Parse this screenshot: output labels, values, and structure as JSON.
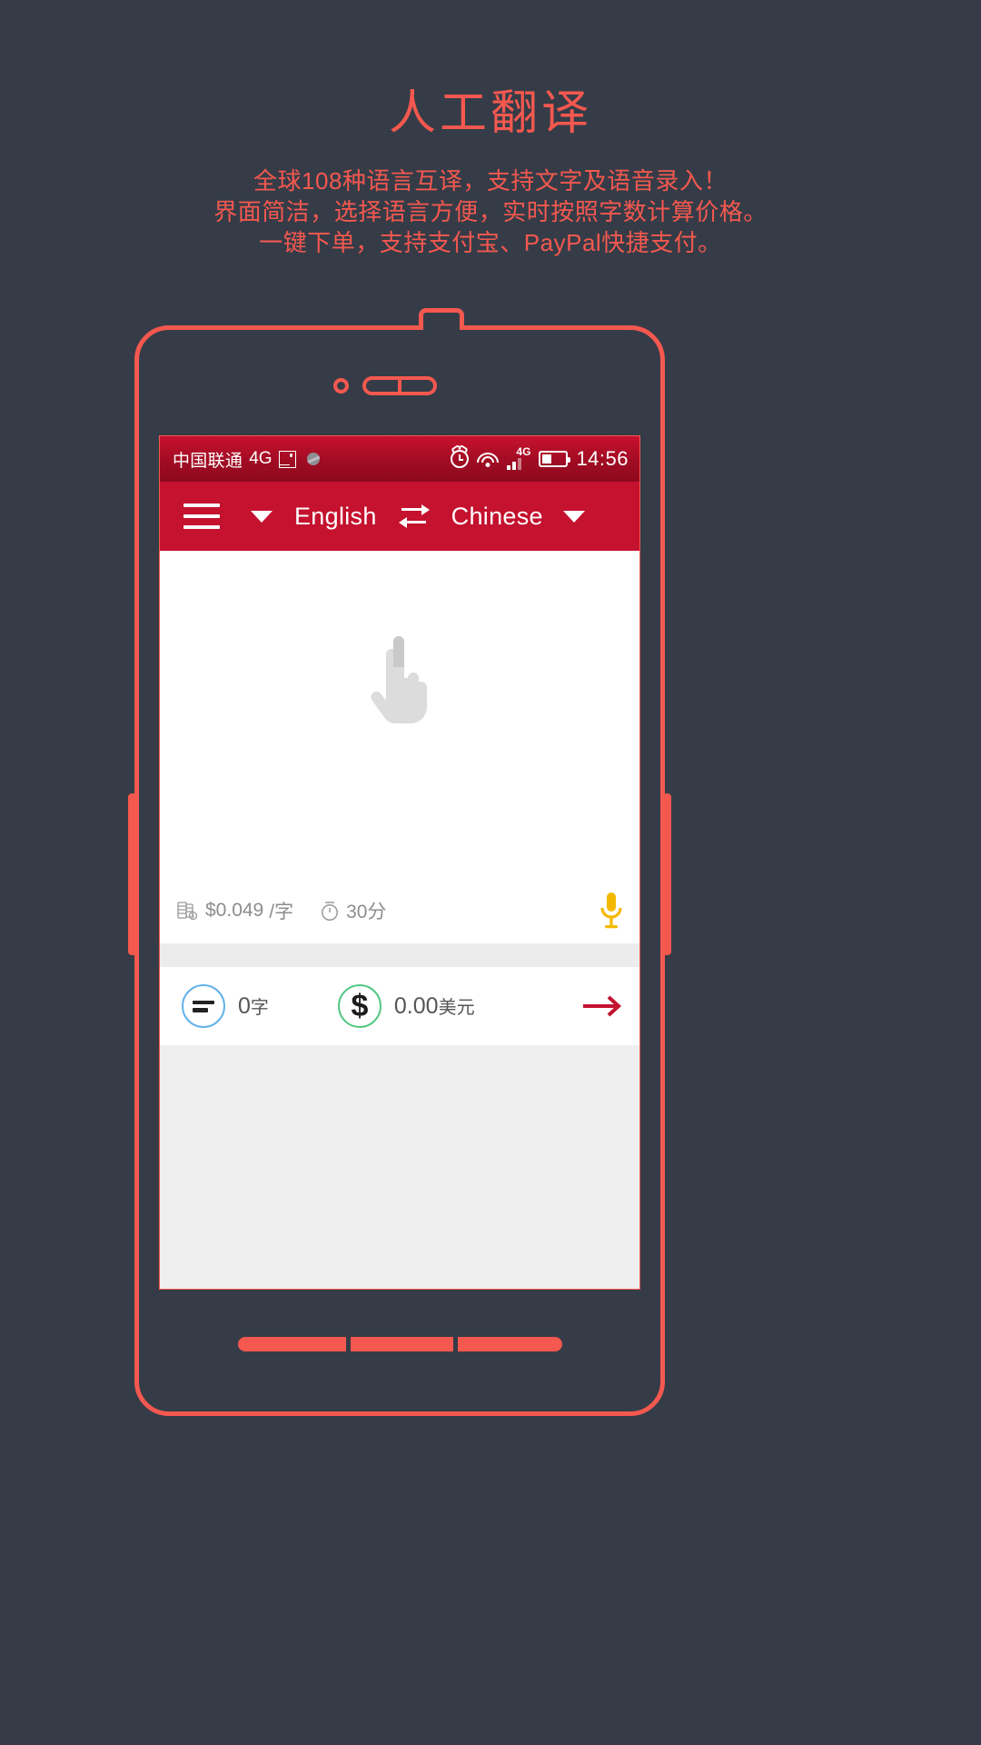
{
  "promo": {
    "title": "人工翻译",
    "lines": [
      "全球108种语言互译，支持文字及语音录入！",
      "界面简洁，选择语言方便，实时按照字数计算价格。",
      "一键下单，支持支付宝、PayPal快捷支付。"
    ],
    "accent_color": "#f4584f",
    "background_color": "#353c47"
  },
  "statusbar": {
    "carrier": "中国联通",
    "network": "4G",
    "signal_tag": "4G",
    "time": "14:56",
    "icons": [
      "screenshot-icon",
      "sync-icon",
      "alarm-icon",
      "wifi-icon",
      "signal-icon",
      "battery-icon"
    ]
  },
  "toolbar": {
    "menu_icon": "hamburger-icon",
    "source_dropdown_icon": "chevron-down-icon",
    "source_language": "English",
    "swap_icon": "swap-languages-icon",
    "target_language": "Chinese",
    "target_dropdown_icon": "chevron-down-icon",
    "background_color": "#c4122f"
  },
  "editor": {
    "placeholder_icon": "tap-hand-icon"
  },
  "price_row": {
    "rate_icon": "coins-icon",
    "rate": "$0.049",
    "rate_unit": "/字",
    "eta_icon": "stopwatch-icon",
    "eta": "30分",
    "mic_icon": "microphone-icon",
    "mic_color": "#f5b800"
  },
  "summary_row": {
    "count_icon": "equals-icon",
    "count_icon_color": "#63b3ea",
    "count": "0",
    "count_unit": "字",
    "price_icon": "dollar-icon",
    "price_icon_color": "#54c884",
    "price": "0.00",
    "price_unit": "美元",
    "submit_icon": "arrow-right-icon",
    "submit_color": "#c4122f"
  }
}
